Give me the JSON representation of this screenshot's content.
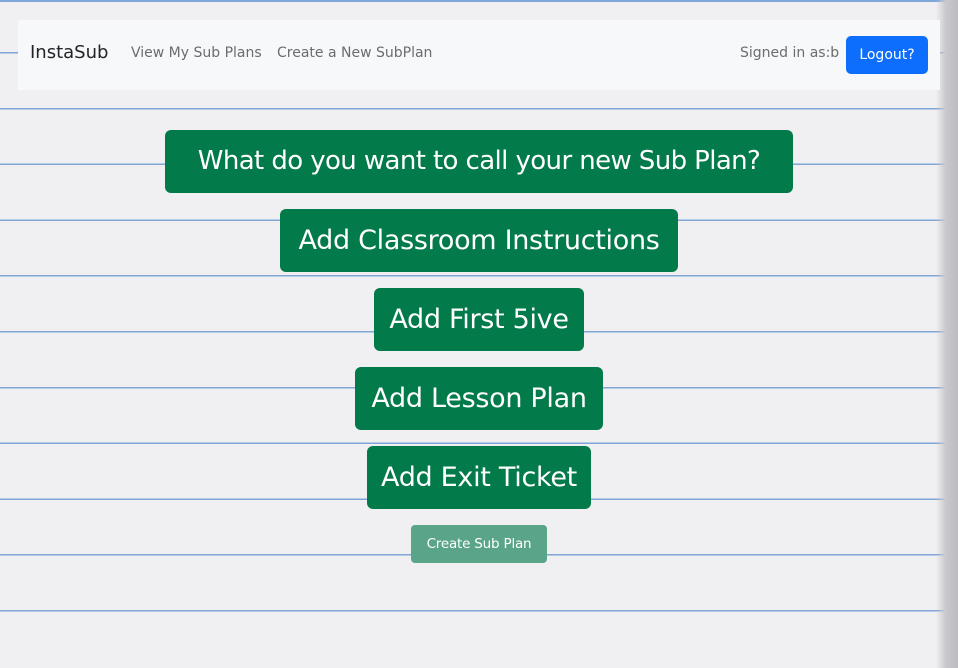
{
  "navbar": {
    "brand": "InstaSub",
    "links": [
      "View My Sub Plans",
      "Create a New SubPlan"
    ],
    "signed_in_label": "Signed in as:b",
    "logout_label": "Logout?"
  },
  "main": {
    "buttons": [
      "What do you want to call your new Sub Plan?",
      "Add Classroom Instructions",
      "Add First 5ive",
      "Add Lesson Plan",
      "Add Exit Ticket"
    ],
    "submit_label": "Create Sub Plan"
  },
  "colors": {
    "primary_green": "#027a4a",
    "submit_green_disabled": "#5aa48a",
    "logout_blue": "#0d6efd",
    "ruled_line_blue": "#7ea6d8"
  }
}
